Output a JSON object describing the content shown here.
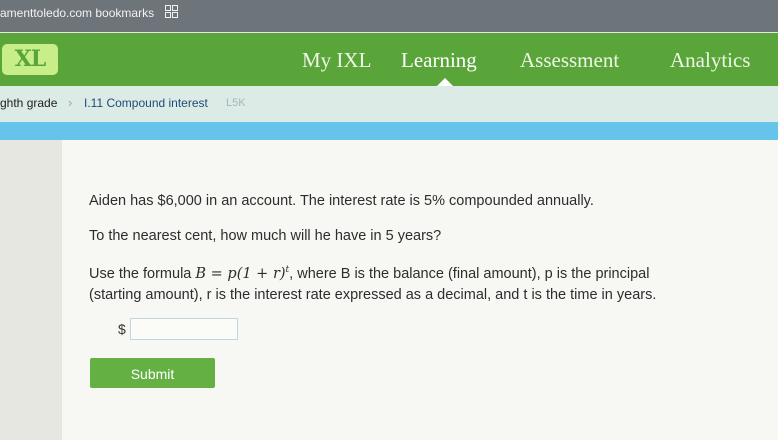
{
  "browser": {
    "bookmarks_text": "amenttoledo.com bookmarks",
    "bookmarks_icon": "grid-icon"
  },
  "nav": {
    "logo": "XL",
    "items": [
      "My IXL",
      "Learning",
      "Assessment",
      "Analytics"
    ],
    "active": "Learning",
    "brand_color": "#5aa53a",
    "accent_color": "#66c4ea"
  },
  "breadcrumb": {
    "grade": "ghth grade",
    "separator": "›",
    "skill": "I.11 Compound interest",
    "code": "L5K"
  },
  "question": {
    "line1": "Aiden has $6,000 in an account. The interest rate is 5% compounded annually.",
    "line2": "To the nearest cent, how much will he have in 5 years?",
    "line3_prefix": "Use the formula ",
    "formula_main": "B = p(1 + r)",
    "formula_exp": "t",
    "line3_suffix": ", where B is the balance (final amount), p is the principal",
    "line4": "(starting amount), r is the interest rate expressed as a decimal, and t is the time in years."
  },
  "answer": {
    "currency_symbol": "$",
    "value": "",
    "placeholder": ""
  },
  "submit_label": "Submit"
}
